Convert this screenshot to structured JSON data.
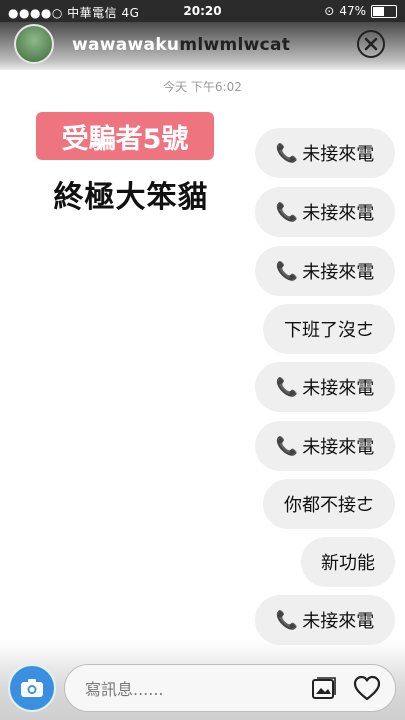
{
  "status_bar": {
    "carrier": "中華電信",
    "network": "4G",
    "time": "20:20",
    "battery": "47%",
    "battery_level": 0.47
  },
  "header": {
    "username": "wawawaku",
    "username_overlay": "mlwmlwcat"
  },
  "chat": {
    "timestamp": "今天 下午6:02",
    "messages": [
      {
        "type": "call",
        "icon": "phone-icon",
        "text": "未接來電"
      },
      {
        "type": "call",
        "icon": "phone-icon",
        "text": "未接來電"
      },
      {
        "type": "call",
        "icon": "phone-icon",
        "text": "未接來電"
      },
      {
        "type": "text",
        "text": "下班了沒ㄜ"
      },
      {
        "type": "call",
        "icon": "phone-icon",
        "text": "未接來電"
      },
      {
        "type": "call",
        "icon": "phone-icon",
        "text": "未接來電"
      },
      {
        "type": "text",
        "text": "你都不接ㄜ"
      },
      {
        "type": "text",
        "text": "新功能"
      },
      {
        "type": "call",
        "icon": "phone-icon",
        "text": "未接來電"
      }
    ]
  },
  "overlay": {
    "tag": "受騙者5號",
    "caption": "終極大笨貓",
    "tag_color": "#ee7480"
  },
  "composer": {
    "placeholder": "寫訊息......",
    "camera_icon": "camera-icon",
    "gallery_icon": "gallery-icon",
    "heart_icon": "heart-icon",
    "accent": "#3b8fe0"
  }
}
